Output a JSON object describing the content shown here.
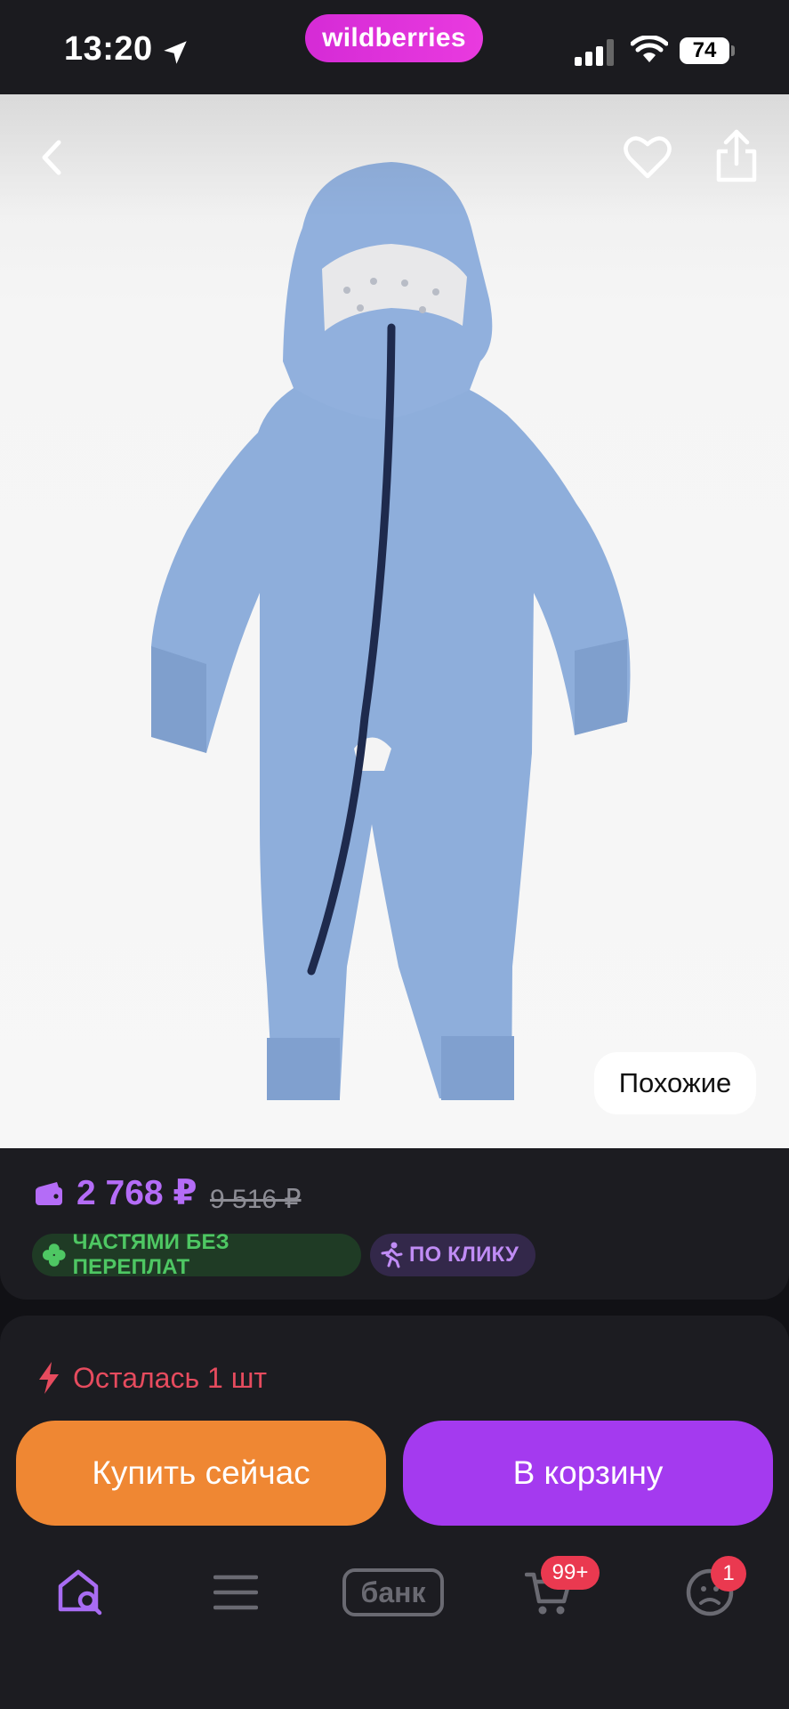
{
  "status_bar": {
    "time": "13:20",
    "brand": "wildberries",
    "battery": "74"
  },
  "product": {
    "similar_label": "Похожие"
  },
  "price": {
    "current": "2 768 ₽",
    "old": "9 516 ₽",
    "accent_color": "#b46cf7"
  },
  "badges": {
    "installment": "ЧАСТЯМИ БЕЗ ПЕРЕПЛАТ",
    "one_click": "ПО КЛИКУ"
  },
  "stock": {
    "text": "Осталась 1 шт"
  },
  "actions": {
    "buy_now": "Купить сейчас",
    "add_to_cart": "В корзину"
  },
  "bottom_nav": {
    "items": [
      {
        "icon": "home-search-icon",
        "label": ""
      },
      {
        "icon": "menu-icon",
        "label": ""
      },
      {
        "icon": "bank-icon",
        "label": "банк"
      },
      {
        "icon": "cart-icon",
        "badge": "99+"
      },
      {
        "icon": "profile-icon",
        "badge": "1"
      }
    ]
  }
}
